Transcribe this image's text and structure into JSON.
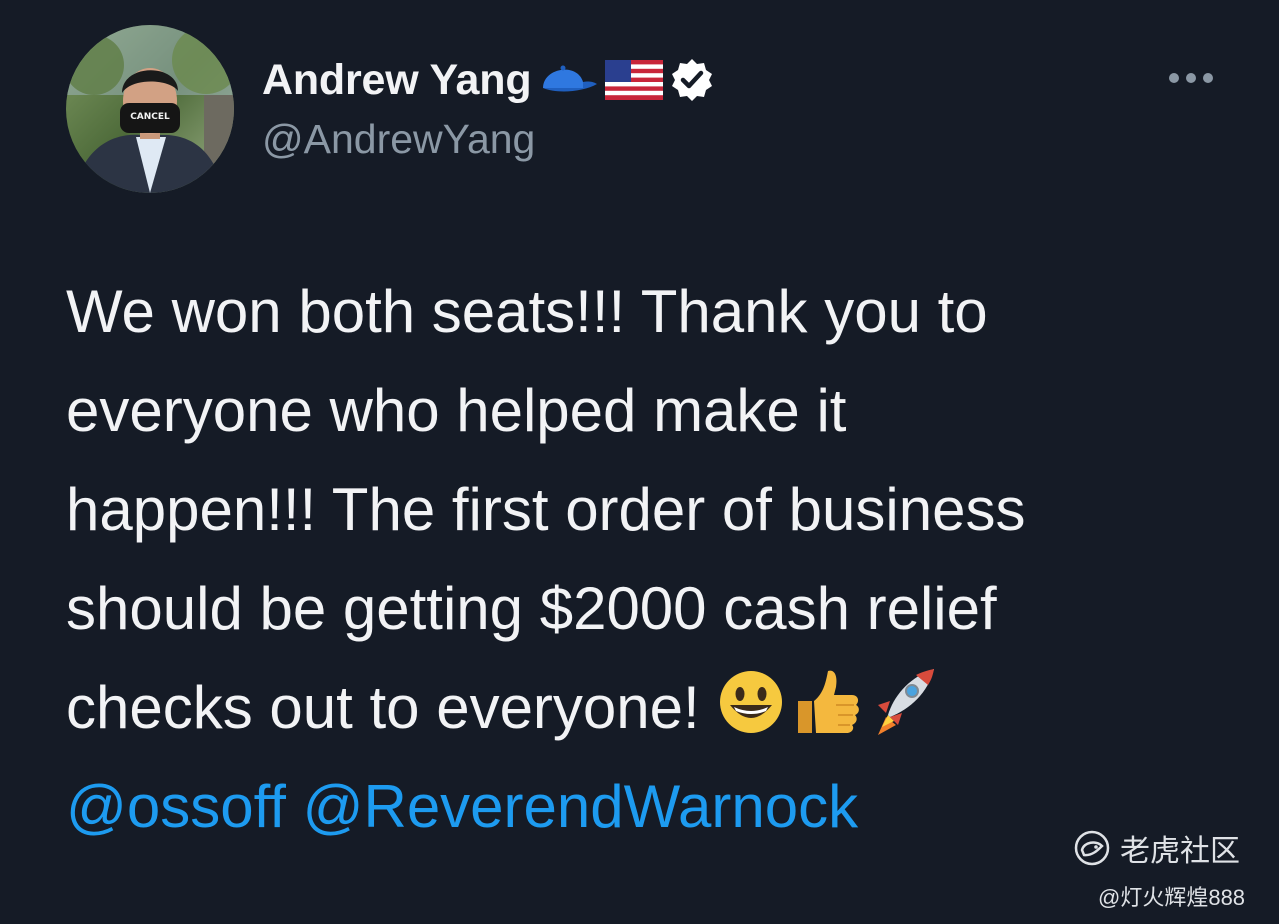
{
  "author": {
    "display_name": "Andrew Yang",
    "handle": "@AndrewYang",
    "avatar_mask_text": "CANCEL",
    "name_icons": [
      "blue-cap-icon",
      "us-flag-icon",
      "verified-badge-icon"
    ]
  },
  "tweet": {
    "lines": [
      "We won both seats!!!  Thank you to",
      "everyone who helped make it",
      "happen!!!  The first order of business",
      "should be getting $2000 cash relief",
      "checks out to everyone! "
    ],
    "trailing_emojis": [
      "grinning-face-icon",
      "thumbs-up-icon",
      "rocket-icon"
    ],
    "mentions": [
      "@ossoff",
      "@ReverendWarnock"
    ]
  },
  "watermark": {
    "brand": "老虎社区",
    "user": "@灯火辉煌888"
  },
  "colors": {
    "background": "#151b26",
    "text": "#f2f3f5",
    "secondary_text": "#8b98a5",
    "mention": "#1d9bf0",
    "verified_badge": "#ffffff"
  }
}
